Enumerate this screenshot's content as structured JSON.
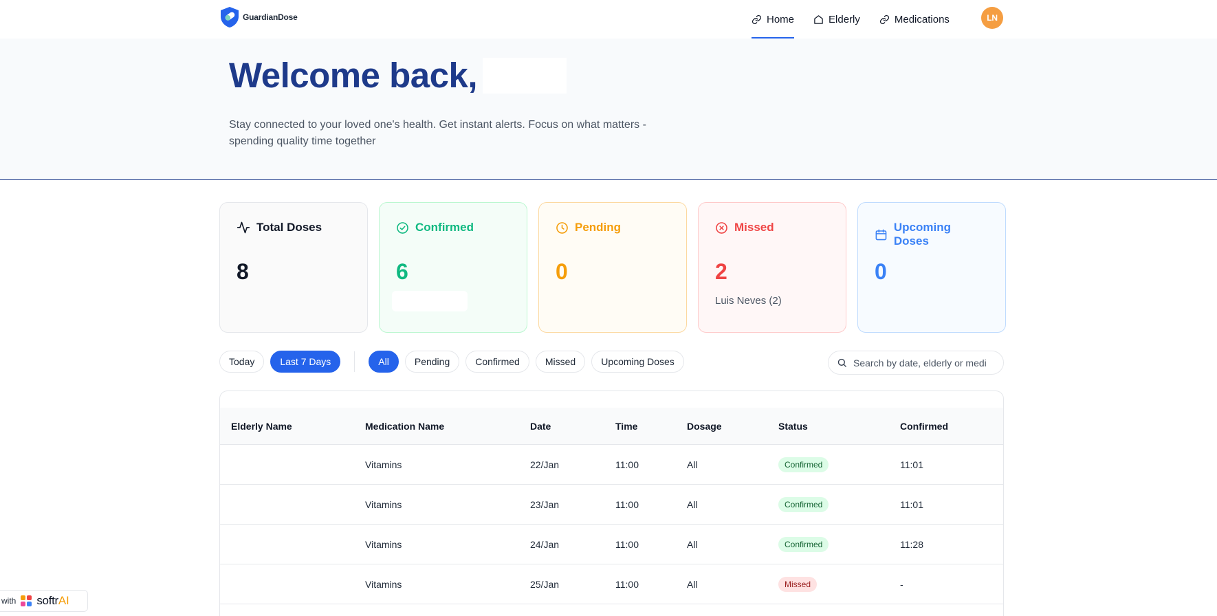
{
  "brand": {
    "name": "GuardianDose",
    "colors": {
      "primary": "#2563eb",
      "heading": "#1e3a8a",
      "avatar": "#f59e42"
    }
  },
  "nav": {
    "items": [
      {
        "label": "Home",
        "icon": "link-icon",
        "active": true
      },
      {
        "label": "Elderly",
        "icon": "home-icon",
        "active": false
      },
      {
        "label": "Medications",
        "icon": "link-icon",
        "active": false
      }
    ],
    "avatar_initials": "LN"
  },
  "hero": {
    "title": "Welcome back,",
    "subtitle": "Stay connected to your loved one's health. Get instant alerts. Focus on what matters - spending quality time together"
  },
  "cards": [
    {
      "key": "total",
      "label": "Total Doses",
      "value": "8",
      "note": "",
      "icon": "activity-icon",
      "color": "#111827"
    },
    {
      "key": "confirmed",
      "label": "Confirmed",
      "value": "6",
      "note": "",
      "icon": "check-circle-icon",
      "color": "#10b981"
    },
    {
      "key": "pending",
      "label": "Pending",
      "value": "0",
      "note": "",
      "icon": "clock-icon",
      "color": "#f59e0b"
    },
    {
      "key": "missed",
      "label": "Missed",
      "value": "2",
      "note": "Luis Neves (2)",
      "icon": "x-circle-icon",
      "color": "#ef4444"
    },
    {
      "key": "upcoming",
      "label": "Upcoming Doses",
      "value": "0",
      "note": "",
      "icon": "calendar-icon",
      "color": "#3b82f6"
    }
  ],
  "filters": {
    "range": [
      {
        "label": "Today",
        "active": false
      },
      {
        "label": "Last 7 Days",
        "active": true
      }
    ],
    "status": [
      {
        "label": "All",
        "active": true
      },
      {
        "label": "Pending",
        "active": false
      },
      {
        "label": "Confirmed",
        "active": false
      },
      {
        "label": "Missed",
        "active": false
      },
      {
        "label": "Upcoming Doses",
        "active": false
      }
    ],
    "search_placeholder": "Search by date, elderly or medi"
  },
  "table": {
    "columns": [
      "Elderly Name",
      "Medication Name",
      "Date",
      "Time",
      "Dosage",
      "Status",
      "Confirmed"
    ],
    "rows": [
      {
        "elderly": "",
        "medication": "Vitamins",
        "date": "22/Jan",
        "time": "11:00",
        "dosage": "All",
        "status": "Confirmed",
        "confirmed": "11:01"
      },
      {
        "elderly": "",
        "medication": "Vitamins",
        "date": "23/Jan",
        "time": "11:00",
        "dosage": "All",
        "status": "Confirmed",
        "confirmed": "11:01"
      },
      {
        "elderly": "",
        "medication": "Vitamins",
        "date": "24/Jan",
        "time": "11:00",
        "dosage": "All",
        "status": "Confirmed",
        "confirmed": "11:28"
      },
      {
        "elderly": "",
        "medication": "Vitamins",
        "date": "25/Jan",
        "time": "11:00",
        "dosage": "All",
        "status": "Missed",
        "confirmed": "-"
      }
    ]
  },
  "footer_badge": {
    "with": "with",
    "name_main": "softr",
    "name_ai": "AI"
  }
}
